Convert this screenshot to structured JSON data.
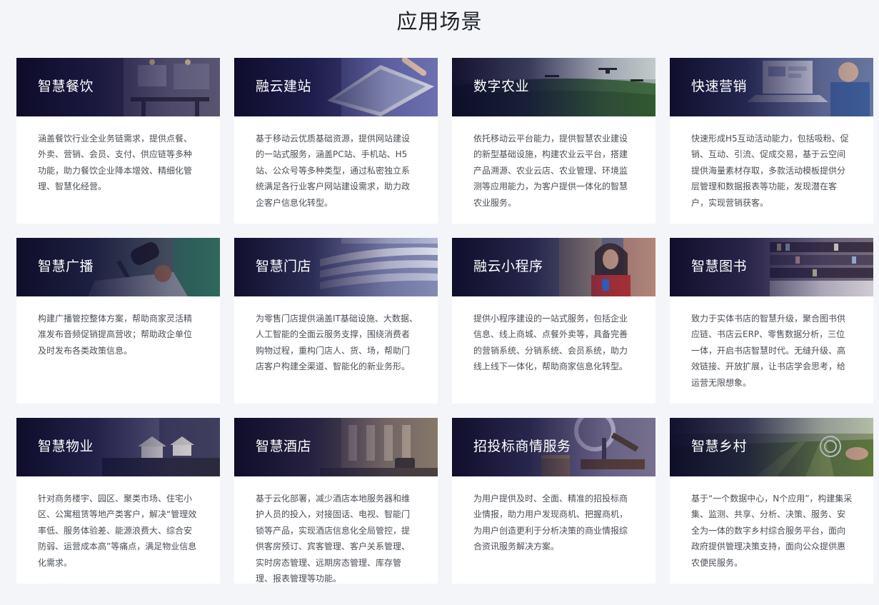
{
  "page": {
    "title": "应用场景"
  },
  "cards": [
    {
      "title": "智慧餐饮",
      "desc": "涵盖餐饮行业全业务链需求，提供点餐、外卖、营销、会员、支付、供应链等多种功能，助力餐饮企业降本增效、精细化管理、智慧化经营。",
      "icon": "restaurant-scene"
    },
    {
      "title": "融云建站",
      "desc": "基于移动云优质基础资源，提供网站建设的一站式服务，涵盖PC站、手机站、H5站、公众号等多种类型，通过私密独立系统满足各行业客户网站建设需求，助力政企客户信息化转型。",
      "icon": "tablet-scene"
    },
    {
      "title": "数字农业",
      "desc": "依托移动云平台能力，提供智慧农业建设的新型基础设施，构建农业云平台，搭建产品溯源、农业云店、农业管理、环境监测等应用能力，为客户提供一体化的智慧农业服务。",
      "icon": "farm-drone-scene"
    },
    {
      "title": "快速营销",
      "desc": "快速形成H5互动活动能力，包括吸粉、促销、互动、引流、促成交易，基于云空间提供海量素材存取，多款活动模板提供分层管理和数据报表等功能，发现潜在客户，实现营销获客。",
      "icon": "laptop-analytics-scene"
    },
    {
      "title": "智慧广播",
      "desc": "构建广播管控整体方案，帮助商家灵活精准发布音频促销提高营收；帮助政企单位及时发布各类政策信息。",
      "icon": "microphone-scene"
    },
    {
      "title": "智慧门店",
      "desc": "为零售门店提供涵盖IT基础设施、大数据、人工智能的全面云服务支撑，围绕消费者购物过程，重构门店人、货、场，帮助门店客户构建全渠道、智能化的新业务形。",
      "icon": "mall-scene"
    },
    {
      "title": "融云小程序",
      "desc": "提供小程序建设的一站式服务，包括企业信息、线上商城、点餐外卖等，具备完善的营销系统、分销系统、会员系统，助力线上线下一体化，帮助商家信息化转型。",
      "icon": "phone-user-scene"
    },
    {
      "title": "智慧图书",
      "desc": "致力于实体书店的智慧升级，聚合图书供应链、书店云ERP、零售数据分析，三位一体，开启书店智慧时代。无缝升级、高效链接、开放扩展，让书店学会思考，给运营无限想象。",
      "icon": "bookstore-scene"
    },
    {
      "title": "智慧物业",
      "desc": "针对商务楼宇、园区、聚类市场、住宅小区、公寓租赁等地产类客户，解决“管理效率低、服务体验差、能源浪费大、综合安防弱、运营成本高”等痛点，满足物业信息化需求。",
      "icon": "house-model-scene"
    },
    {
      "title": "智慧酒店",
      "desc": "基于云化部署，减少酒店本地服务器和维护人员的投入，对接固话、电视、智能门锁等产品，实现酒店信息化全局管控，提供客房预订、宾客管理、客户关系管理、实时房态管理、远期房态管理、库存管理、报表管理等功能。",
      "icon": "hotel-lobby-scene"
    },
    {
      "title": "招投标商情服务",
      "desc": "为用户提供及时、全面、精准的招投标商业情报，助力用户发现商机、把握商机，为用户创造更利于分析决策的商业情报综合资讯服务解决方案。",
      "icon": "magnifier-coins-scene"
    },
    {
      "title": "智慧乡村",
      "desc": "基于“一个数据中心，N个应用”，构建集采集、监测、共享、分析、决策、服务、安全为一体的数字乡村综合服务平台，面向政府提供管理决策支持，面向公众提供惠农便民服务。",
      "icon": "village-field-scene"
    }
  ],
  "colors": {
    "background": "#f3f5f8",
    "card": "#ffffff",
    "banner_overlay": "#12103a",
    "title_text": "#1f2329",
    "desc_text": "#4a4f57"
  }
}
